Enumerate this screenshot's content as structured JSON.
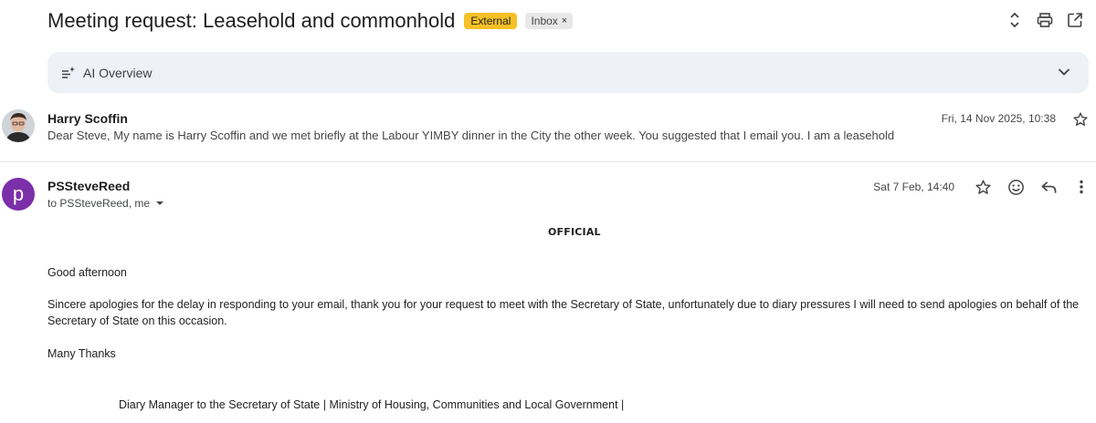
{
  "thread": {
    "subject": "Meeting request: Leasehold and commonhold",
    "labels": {
      "external": "External",
      "inbox": "Inbox",
      "inbox_remove": "×"
    }
  },
  "icons": {
    "expand": "unfold-more-icon",
    "print": "print-icon",
    "open_new": "open-in-new-window-icon",
    "ai": "sparkle-list-icon",
    "chevron": "chevron-down-icon",
    "star": "star-outline-icon",
    "emoji": "emoji-smile-icon",
    "reply": "reply-icon",
    "more": "more-vertical-icon"
  },
  "ai_overview": {
    "label": "AI Overview"
  },
  "message1": {
    "sender": "Harry Scoffin",
    "date": "Fri, 14 Nov 2025, 10:38",
    "snippet": "Dear Steve, My name is Harry Scoffin and we met briefly at the Labour YIMBY dinner in the City the other week. You suggested that I email you. I am a leasehold"
  },
  "message2": {
    "sender": "PSSteveReed",
    "avatar_letter": "p",
    "to_line": "to PSSteveReed, me",
    "date": "Sat 7 Feb, 14:40",
    "classification": "OFFICIAL",
    "greeting": "Good afternoon",
    "body": "Sincere apologies for the delay in responding to your email, thank you for your request to meet with the Secretary of State, unfortunately due to diary pressures I will need to send apologies on behalf of the Secretary of State on this occasion.",
    "signoff": "Many Thanks",
    "signature": "Diary Manager to the Secretary of State | Ministry of Housing, Communities and Local Government |"
  },
  "colors": {
    "external_label": "#f6c026",
    "inbox_label": "#e8e8e8",
    "ai_overview_bg": "#eef1f8",
    "avatar_p": "#7b2fa8"
  }
}
